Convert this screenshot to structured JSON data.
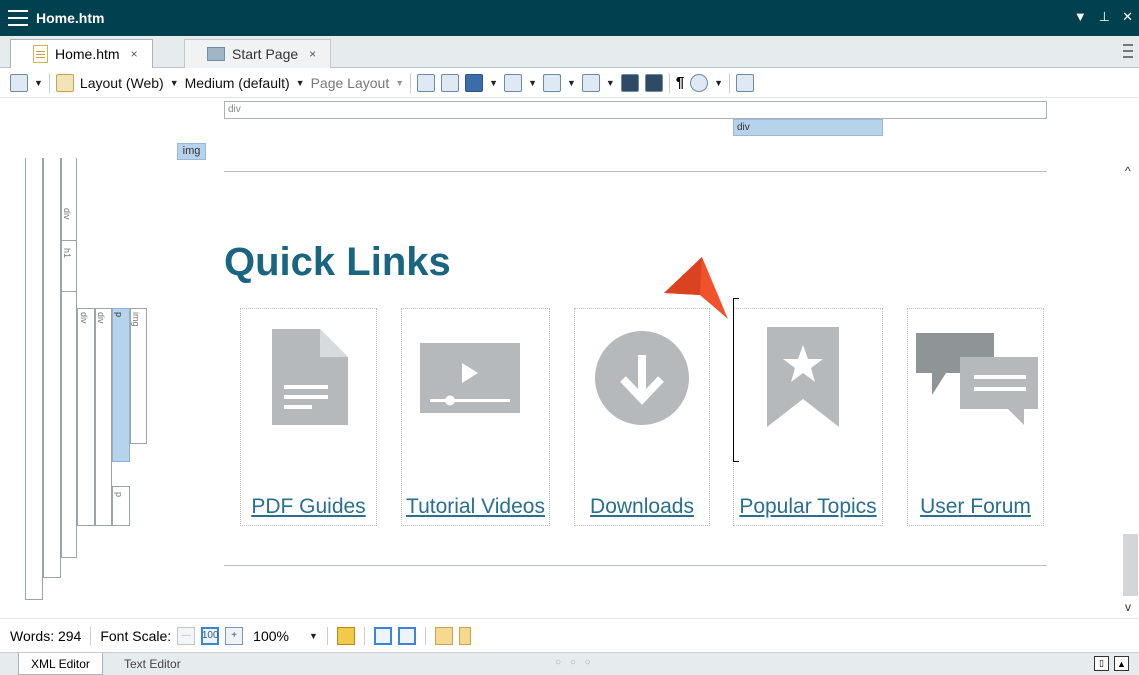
{
  "window": {
    "title": "Home.htm"
  },
  "tabs": [
    {
      "label": "Home.htm",
      "close": "×"
    },
    {
      "label": "Start Page",
      "close": "×"
    }
  ],
  "toolbar": {
    "layout_label": "Layout (Web)",
    "medium_label": "Medium (default)",
    "page_layout_label": "Page Layout",
    "pilcrow": "¶"
  },
  "structure": {
    "top_bar": "div",
    "div_bar": "div",
    "img_bar": "img",
    "left_labels": [
      "div",
      "h1",
      "div",
      "div",
      "p",
      "img",
      "p"
    ]
  },
  "content": {
    "heading": "Quick Links",
    "cards": [
      {
        "label": "PDF Guides",
        "icon": "document-icon"
      },
      {
        "label": "Tutorial Videos",
        "icon": "video-icon"
      },
      {
        "label": "Downloads",
        "icon": "download-icon"
      },
      {
        "label": "Popular Topics",
        "icon": "bookmark-star-icon"
      },
      {
        "label": "User Forum",
        "icon": "chat-icon"
      }
    ],
    "icon_color": "#b5b9bc",
    "link_color": "#2a6f91",
    "heading_color": "#1a6582",
    "pointer_color": "#f0532c"
  },
  "statusbar": {
    "words": "Words: 294",
    "font_scale": "Font Scale:",
    "zoom": "100%"
  },
  "bottom_tabs": {
    "xml_editor": "XML Editor",
    "text_editor": "Text Editor",
    "grip": "○ ○ ○"
  },
  "colors": {
    "titlebar": "#00404f",
    "selection": "#b7d3ec"
  }
}
